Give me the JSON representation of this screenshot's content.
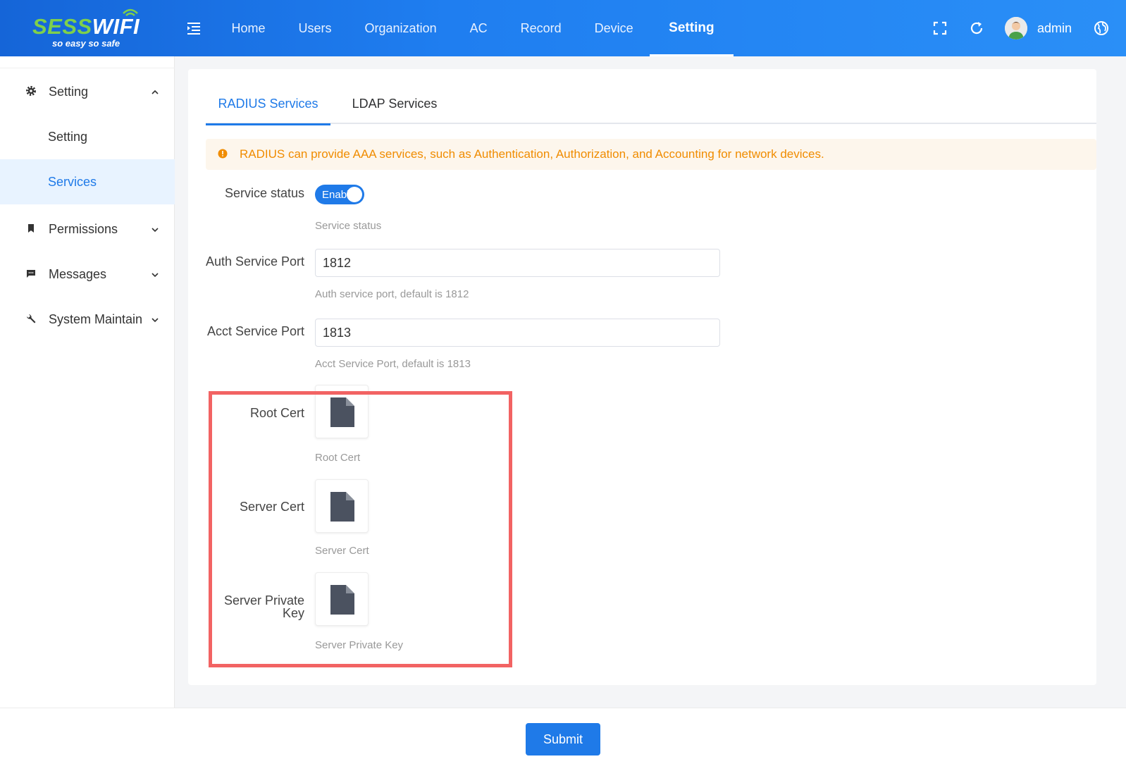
{
  "brand": {
    "name_green": "SESS",
    "name_white": "WIFI",
    "slogan": "so easy so safe",
    "accent": "#7ed04b"
  },
  "header": {
    "nav": [
      "Home",
      "Users",
      "Organization",
      "AC",
      "Record",
      "Device",
      "Setting"
    ],
    "active_nav": "Setting",
    "user": "admin",
    "icons": [
      "menu-fold-icon",
      "fullscreen-icon",
      "refresh-icon",
      "avatar",
      "globe-icon"
    ]
  },
  "sidebar": {
    "setting_group": "Setting",
    "setting_sub": "Setting",
    "services_sub": "Services",
    "permissions": "Permissions",
    "messages": "Messages",
    "system_maintain": "System Maintain"
  },
  "tabs": {
    "radius": "RADIUS Services",
    "ldap": "LDAP Services"
  },
  "alert": "RADIUS can provide AAA services, such as Authentication, Authorization, and Accounting for network devices.",
  "form": {
    "service_status_label": "Service status",
    "service_status_value": "Enable",
    "service_status_hint": "Service status",
    "auth_port_label": "Auth Service Port",
    "auth_port_value": "1812",
    "auth_port_hint": "Auth service port, default is 1812",
    "acct_port_label": "Acct Service Port",
    "acct_port_value": "1813",
    "acct_port_hint": "Acct Service Port, default is 1813",
    "root_cert_label": "Root Cert",
    "root_cert_hint": "Root Cert",
    "server_cert_label": "Server Cert",
    "server_cert_hint": "Server Cert",
    "server_key_label_1": "Server Private",
    "server_key_label_2": "Key",
    "server_key_hint": "Server Private Key"
  },
  "footer": {
    "submit": "Submit"
  },
  "colors": {
    "primary": "#1f7ae8",
    "warning": "#f08c00",
    "highlight": "#f26363"
  }
}
